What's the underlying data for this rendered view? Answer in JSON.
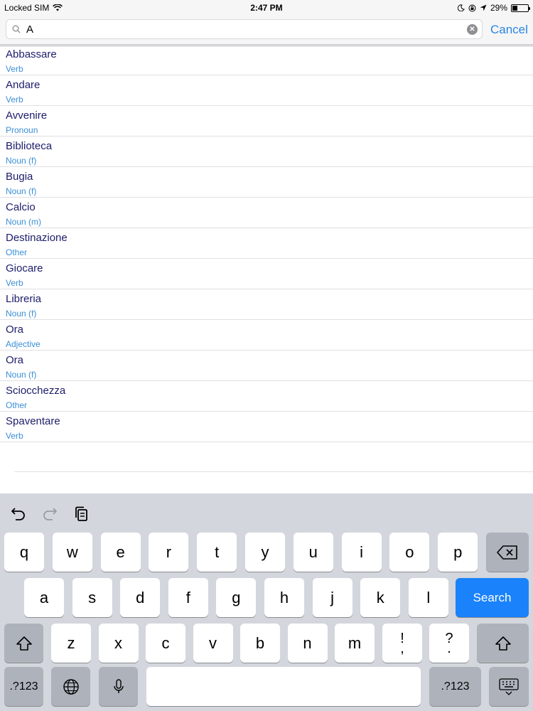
{
  "status_bar": {
    "carrier": "Locked SIM",
    "time": "2:47 PM",
    "battery": "29%",
    "battery_level": 0.29
  },
  "search": {
    "value": "A",
    "cancel_label": "Cancel"
  },
  "results": [
    {
      "title": "Abbassare",
      "subtitle": "Verb"
    },
    {
      "title": "Andare",
      "subtitle": "Verb"
    },
    {
      "title": "Avvenire",
      "subtitle": "Pronoun"
    },
    {
      "title": "Biblioteca",
      "subtitle": "Noun (f)"
    },
    {
      "title": "Bugia",
      "subtitle": "Noun (f)"
    },
    {
      "title": "Calcio",
      "subtitle": "Noun (m)"
    },
    {
      "title": "Destinazione",
      "subtitle": "Other"
    },
    {
      "title": "Giocare",
      "subtitle": "Verb"
    },
    {
      "title": "Libreria",
      "subtitle": "Noun (f)"
    },
    {
      "title": "Ora",
      "subtitle": "Adjective"
    },
    {
      "title": "Ora",
      "subtitle": "Noun (f)"
    },
    {
      "title": "Sciocchezza",
      "subtitle": "Other"
    },
    {
      "title": "Spaventare",
      "subtitle": "Verb"
    }
  ],
  "keyboard": {
    "row1": [
      "q",
      "w",
      "e",
      "r",
      "t",
      "y",
      "u",
      "i",
      "o",
      "p"
    ],
    "row2": [
      "a",
      "s",
      "d",
      "f",
      "g",
      "h",
      "j",
      "k",
      "l"
    ],
    "row3": [
      "z",
      "x",
      "c",
      "v",
      "b",
      "n",
      "m"
    ],
    "search_label": "Search",
    "numbers_label": ".?123",
    "punct_left": [
      "!",
      ","
    ],
    "punct_right": [
      "?",
      "."
    ]
  },
  "colors": {
    "accent": "#2b86e0",
    "search_key": "#1a82fb",
    "title_text": "#1c1c6b",
    "subtitle_text": "#3a8fd6"
  }
}
